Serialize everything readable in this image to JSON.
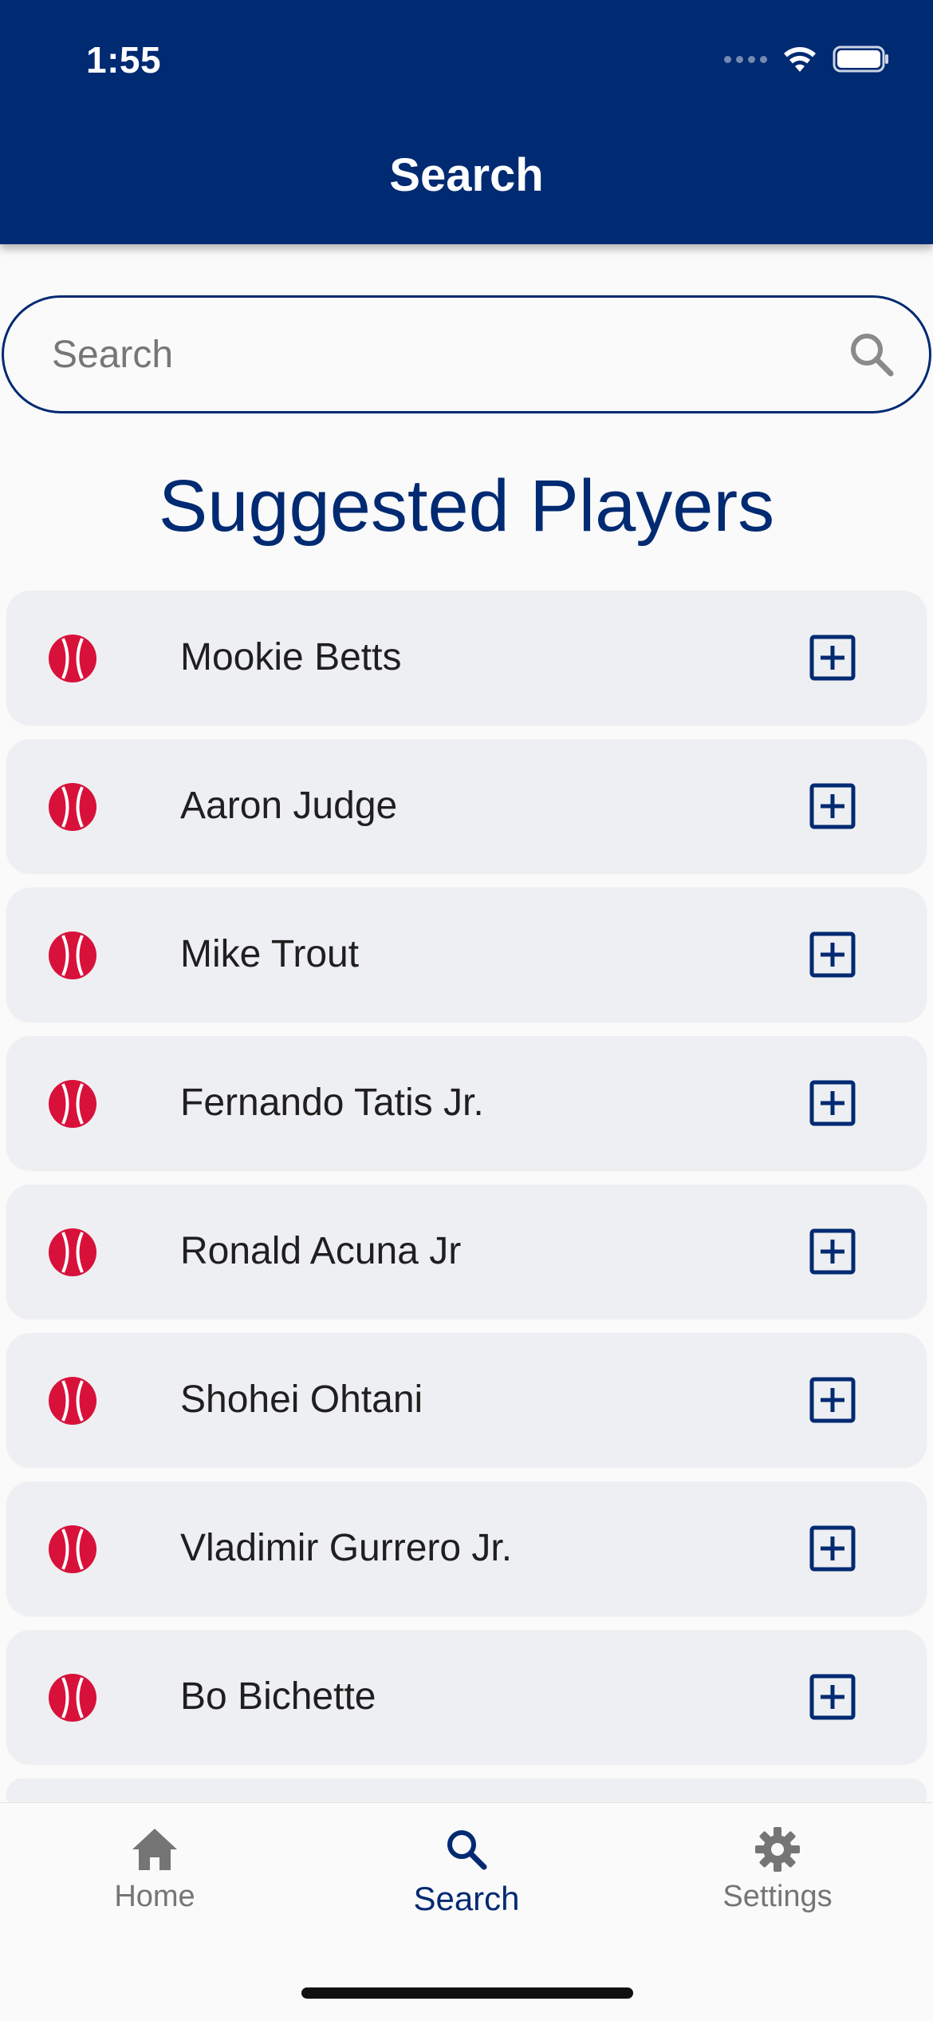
{
  "status_bar": {
    "time": "1:55"
  },
  "header": {
    "title": "Search"
  },
  "search": {
    "placeholder": "Search",
    "value": ""
  },
  "section": {
    "title": "Suggested Players"
  },
  "players": [
    {
      "name": "Mookie Betts"
    },
    {
      "name": "Aaron Judge"
    },
    {
      "name": "Mike Trout"
    },
    {
      "name": "Fernando Tatis Jr."
    },
    {
      "name": "Ronald Acuna Jr"
    },
    {
      "name": "Shohei Ohtani"
    },
    {
      "name": "Vladimir Gurrero Jr."
    },
    {
      "name": "Bo Bichette"
    }
  ],
  "icons": {
    "player_icon": "baseball-icon",
    "add_icon": "plus-square-icon",
    "search_icon": "search-icon"
  },
  "tabs": [
    {
      "label": "Home",
      "icon": "home-icon",
      "active": false
    },
    {
      "label": "Search",
      "icon": "search-icon",
      "active": true
    },
    {
      "label": "Settings",
      "icon": "gear-icon",
      "active": false
    }
  ],
  "colors": {
    "primary": "#002a72",
    "accent": "#d8113a",
    "card_background": "#eeeff2",
    "inactive_tab": "#757575"
  }
}
